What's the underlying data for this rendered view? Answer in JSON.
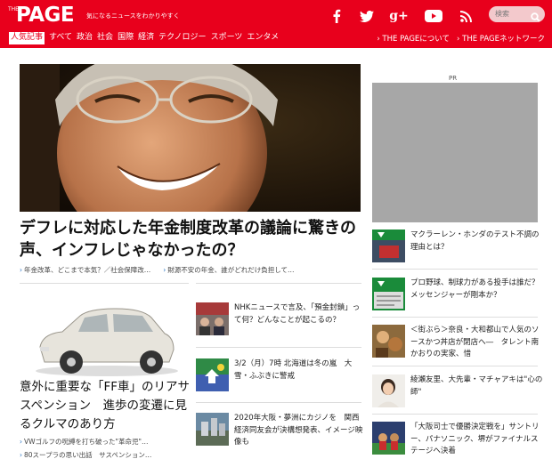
{
  "header": {
    "logo_small": "THE",
    "logo_main": "PAGE",
    "tagline": "気になるニュースをわかりやすく",
    "search_placeholder": "検索",
    "brand_color": "#e8001c",
    "social_icons": [
      "facebook-icon",
      "twitter-icon",
      "google-plus-icon",
      "youtube-icon",
      "rss-icon"
    ]
  },
  "nav": {
    "items": [
      "人気記事",
      "すべて",
      "政治",
      "社会",
      "国際",
      "経済",
      "テクノロジー",
      "スポーツ",
      "エンタメ"
    ],
    "right": [
      "› THE PAGEについて",
      "› THE PAGEネットワーク"
    ]
  },
  "hero": {
    "title": "デフレに対応した年金制度改革の議論に驚きの声、インフレじゃなかったの？",
    "links": [
      "年金改革、どこまで本気？／社会保障改…",
      "財源不安の年金、誰がどれだけ負担して…"
    ]
  },
  "left_article": {
    "title": "意外に重要な「FF車」のリアサスペンション　進歩の変遷に見るクルマのあり方",
    "links": [
      "VWゴルフの呪縛を打ち破った\"革命児\"…",
      "80スープラの思い出話　サスペンション…"
    ]
  },
  "middle_list": [
    {
      "text": "NHKニュースで言及、「預金封鎖」って何？どんなことが起こるの？"
    },
    {
      "text": "3/2（月）7時 北海道は冬の嵐　大雪・ふぶきに警戒"
    },
    {
      "text": "2020年大阪・夢洲にカジノを　関西経済同友会が決構想発表、イメージ映像も"
    }
  ],
  "right": {
    "pr_label": "PR",
    "items": [
      {
        "text": "マクラーレン・ホンダのテスト不調の理由とは？"
      },
      {
        "text": "プロ野球、制球力がある投手は誰だ？　メッセンジャーが剛本か？"
      },
      {
        "text": "＜街ぶら＞奈良・大和都山で人気のソースかつ丼店が閉店へ―　タレント南かおりの実家、惜"
      },
      {
        "text": "綾瀬友里、大先輩・マチャアキは\"心の師\""
      },
      {
        "text": "「大阪司士で優勝決定戦を」サントリー、パナソニック、堺がファイナルステージへ決着"
      }
    ]
  }
}
